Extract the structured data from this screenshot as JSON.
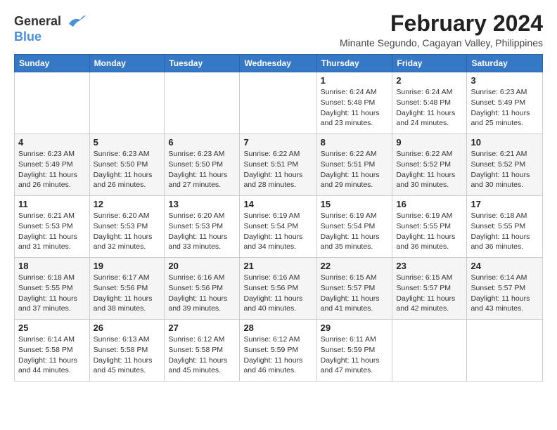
{
  "logo": {
    "line1": "General",
    "line2": "Blue"
  },
  "title": "February 2024",
  "location": "Minante Segundo, Cagayan Valley, Philippines",
  "days_of_week": [
    "Sunday",
    "Monday",
    "Tuesday",
    "Wednesday",
    "Thursday",
    "Friday",
    "Saturday"
  ],
  "weeks": [
    [
      {
        "day": "",
        "info": ""
      },
      {
        "day": "",
        "info": ""
      },
      {
        "day": "",
        "info": ""
      },
      {
        "day": "",
        "info": ""
      },
      {
        "day": "1",
        "info": "Sunrise: 6:24 AM\nSunset: 5:48 PM\nDaylight: 11 hours\nand 23 minutes."
      },
      {
        "day": "2",
        "info": "Sunrise: 6:24 AM\nSunset: 5:48 PM\nDaylight: 11 hours\nand 24 minutes."
      },
      {
        "day": "3",
        "info": "Sunrise: 6:23 AM\nSunset: 5:49 PM\nDaylight: 11 hours\nand 25 minutes."
      }
    ],
    [
      {
        "day": "4",
        "info": "Sunrise: 6:23 AM\nSunset: 5:49 PM\nDaylight: 11 hours\nand 26 minutes."
      },
      {
        "day": "5",
        "info": "Sunrise: 6:23 AM\nSunset: 5:50 PM\nDaylight: 11 hours\nand 26 minutes."
      },
      {
        "day": "6",
        "info": "Sunrise: 6:23 AM\nSunset: 5:50 PM\nDaylight: 11 hours\nand 27 minutes."
      },
      {
        "day": "7",
        "info": "Sunrise: 6:22 AM\nSunset: 5:51 PM\nDaylight: 11 hours\nand 28 minutes."
      },
      {
        "day": "8",
        "info": "Sunrise: 6:22 AM\nSunset: 5:51 PM\nDaylight: 11 hours\nand 29 minutes."
      },
      {
        "day": "9",
        "info": "Sunrise: 6:22 AM\nSunset: 5:52 PM\nDaylight: 11 hours\nand 30 minutes."
      },
      {
        "day": "10",
        "info": "Sunrise: 6:21 AM\nSunset: 5:52 PM\nDaylight: 11 hours\nand 30 minutes."
      }
    ],
    [
      {
        "day": "11",
        "info": "Sunrise: 6:21 AM\nSunset: 5:53 PM\nDaylight: 11 hours\nand 31 minutes."
      },
      {
        "day": "12",
        "info": "Sunrise: 6:20 AM\nSunset: 5:53 PM\nDaylight: 11 hours\nand 32 minutes."
      },
      {
        "day": "13",
        "info": "Sunrise: 6:20 AM\nSunset: 5:53 PM\nDaylight: 11 hours\nand 33 minutes."
      },
      {
        "day": "14",
        "info": "Sunrise: 6:19 AM\nSunset: 5:54 PM\nDaylight: 11 hours\nand 34 minutes."
      },
      {
        "day": "15",
        "info": "Sunrise: 6:19 AM\nSunset: 5:54 PM\nDaylight: 11 hours\nand 35 minutes."
      },
      {
        "day": "16",
        "info": "Sunrise: 6:19 AM\nSunset: 5:55 PM\nDaylight: 11 hours\nand 36 minutes."
      },
      {
        "day": "17",
        "info": "Sunrise: 6:18 AM\nSunset: 5:55 PM\nDaylight: 11 hours\nand 36 minutes."
      }
    ],
    [
      {
        "day": "18",
        "info": "Sunrise: 6:18 AM\nSunset: 5:55 PM\nDaylight: 11 hours\nand 37 minutes."
      },
      {
        "day": "19",
        "info": "Sunrise: 6:17 AM\nSunset: 5:56 PM\nDaylight: 11 hours\nand 38 minutes."
      },
      {
        "day": "20",
        "info": "Sunrise: 6:16 AM\nSunset: 5:56 PM\nDaylight: 11 hours\nand 39 minutes."
      },
      {
        "day": "21",
        "info": "Sunrise: 6:16 AM\nSunset: 5:56 PM\nDaylight: 11 hours\nand 40 minutes."
      },
      {
        "day": "22",
        "info": "Sunrise: 6:15 AM\nSunset: 5:57 PM\nDaylight: 11 hours\nand 41 minutes."
      },
      {
        "day": "23",
        "info": "Sunrise: 6:15 AM\nSunset: 5:57 PM\nDaylight: 11 hours\nand 42 minutes."
      },
      {
        "day": "24",
        "info": "Sunrise: 6:14 AM\nSunset: 5:57 PM\nDaylight: 11 hours\nand 43 minutes."
      }
    ],
    [
      {
        "day": "25",
        "info": "Sunrise: 6:14 AM\nSunset: 5:58 PM\nDaylight: 11 hours\nand 44 minutes."
      },
      {
        "day": "26",
        "info": "Sunrise: 6:13 AM\nSunset: 5:58 PM\nDaylight: 11 hours\nand 45 minutes."
      },
      {
        "day": "27",
        "info": "Sunrise: 6:12 AM\nSunset: 5:58 PM\nDaylight: 11 hours\nand 45 minutes."
      },
      {
        "day": "28",
        "info": "Sunrise: 6:12 AM\nSunset: 5:59 PM\nDaylight: 11 hours\nand 46 minutes."
      },
      {
        "day": "29",
        "info": "Sunrise: 6:11 AM\nSunset: 5:59 PM\nDaylight: 11 hours\nand 47 minutes."
      },
      {
        "day": "",
        "info": ""
      },
      {
        "day": "",
        "info": ""
      }
    ]
  ]
}
